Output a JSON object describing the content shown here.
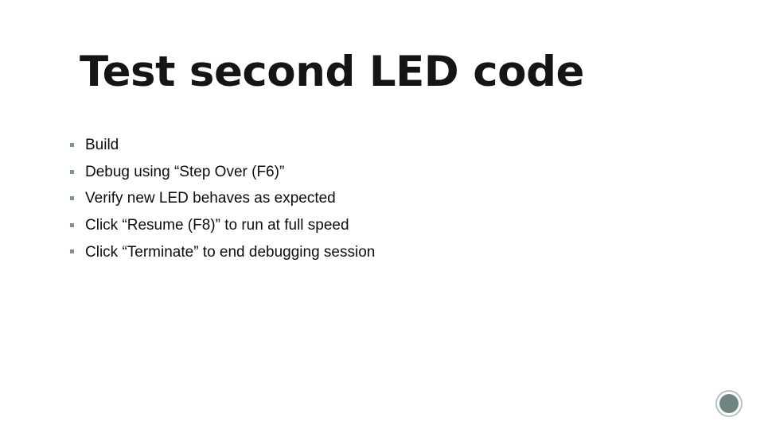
{
  "slide": {
    "title": "Test second LED code",
    "background_color": "#ffffff",
    "title_color": "#151515",
    "body_text_color": "#0d0d0d",
    "bullets": [
      {
        "text": "Build"
      },
      {
        "text": "Debug using “Step Over (F6)”"
      },
      {
        "text": "Verify new LED behaves as expected"
      },
      {
        "text": "Click “Resume (F8)” to run at full speed"
      },
      {
        "text": "Click “Terminate” to end debugging session"
      }
    ],
    "bullet_marker": {
      "shape": "square",
      "color": "#7e9491"
    },
    "decoration": {
      "name": "circle-accent",
      "ring_color": "#b9c4c2",
      "fill_color": "#6f8584"
    }
  }
}
